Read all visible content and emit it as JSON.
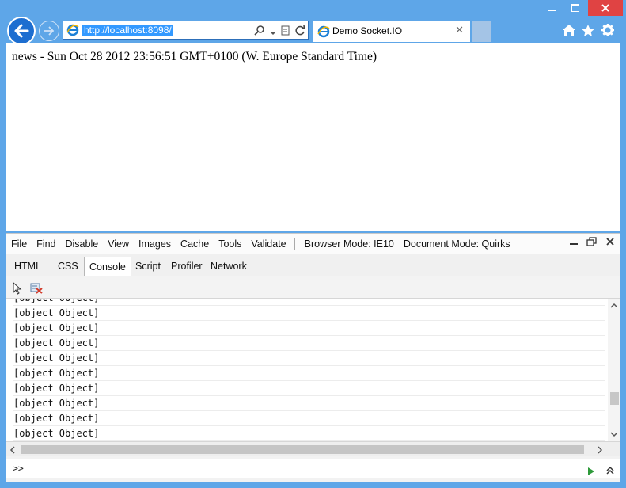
{
  "window": {
    "address_url": "http://localhost:8098/",
    "tab_title": "Demo Socket.IO",
    "tab_close": "✕"
  },
  "page": {
    "news_text": "news - Sun Oct 28 2012 23:56:51 GMT+0100 (W. Europe Standard Time)"
  },
  "devtools": {
    "menu": {
      "file": "File",
      "find": "Find",
      "disable": "Disable",
      "view": "View",
      "images": "Images",
      "cache": "Cache",
      "tools": "Tools",
      "validate": "Validate",
      "browser_mode": "Browser Mode:  IE10",
      "document_mode": "Document Mode:  Quirks"
    },
    "tabs": {
      "html": "HTML",
      "css": "CSS",
      "console": "Console",
      "script": "Script",
      "profiler": "Profiler",
      "network": "Network"
    },
    "console_rows": [
      "[object Object]",
      "[object Object]",
      "[object Object]",
      "[object Object]",
      "[object Object]",
      "[object Object]",
      "[object Object]",
      "[object Object]",
      "[object Object]",
      "[object Object]"
    ],
    "prompt": ">>"
  },
  "colors": {
    "frame": "#5ea6e8",
    "close": "#e04343",
    "selection": "#3399ff"
  },
  "icons": [
    "back-arrow-icon",
    "forward-arrow-icon",
    "ie-logo-icon",
    "search-icon",
    "dropdown-icon",
    "compatibility-icon",
    "refresh-icon",
    "home-icon",
    "favorites-star-icon",
    "settings-gear-icon",
    "select-element-icon",
    "clear-console-icon",
    "run-script-icon",
    "expand-icon"
  ]
}
